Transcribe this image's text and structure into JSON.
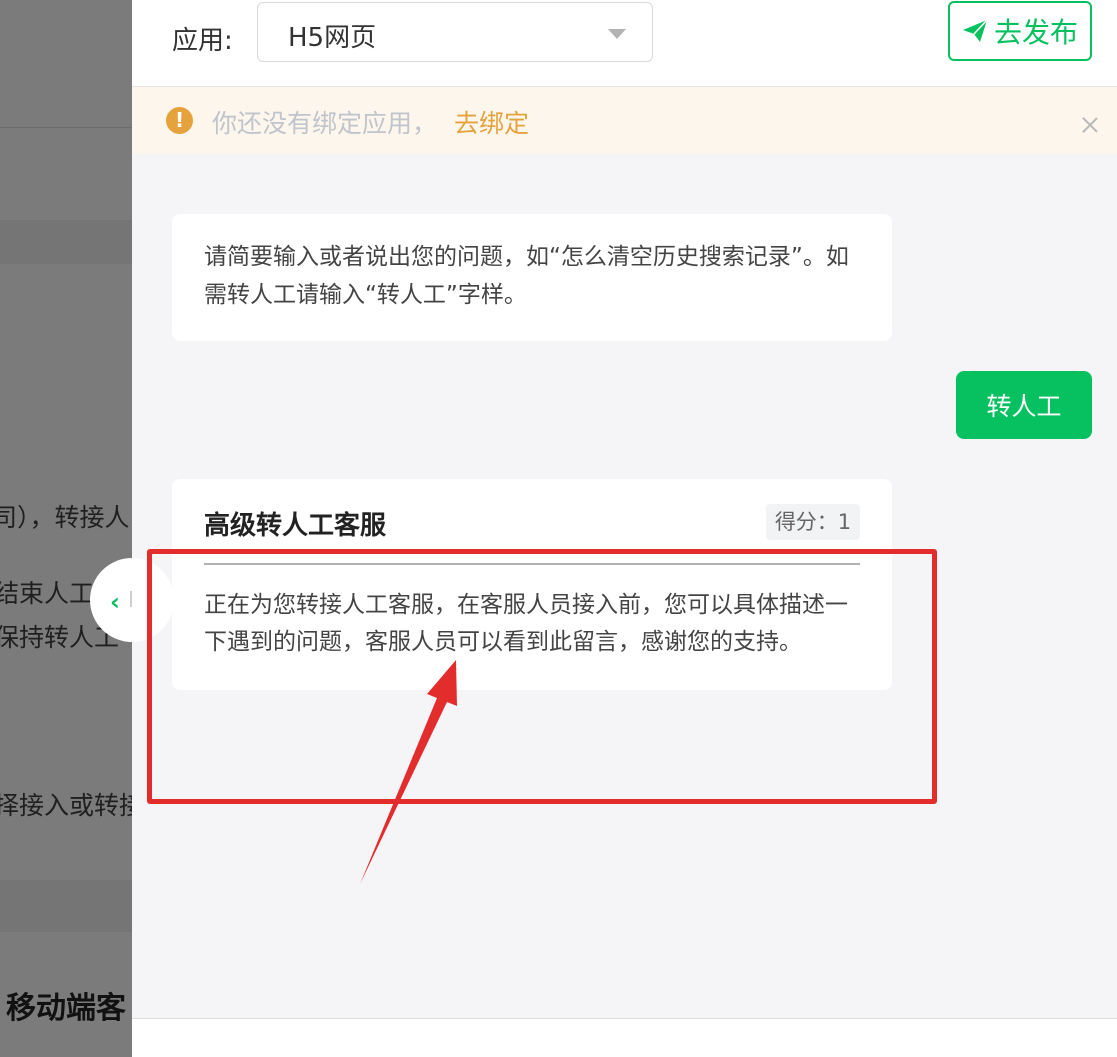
{
  "background": {
    "snippets": [
      "司），转接人",
      "结束人工",
      "保持转人工",
      "择接入或转接"
    ],
    "section_title": "移动端客"
  },
  "topbar": {
    "app_label": "应用:",
    "app_select_value": "H5网页",
    "publish_label": "去发布",
    "publish_icon": "paper-plane-icon"
  },
  "warning": {
    "text": "你还没有绑定应用，",
    "link": "去绑定",
    "icon": "exclamation-icon",
    "color": "#e6a23c"
  },
  "chat": {
    "bot_message": "请简要输入或者说出您的问题，如“怎么清空历史搜索记录”。如需转人工请输入“转人工”字样。",
    "user_message": "转人工",
    "card": {
      "title": "高级转人工客服",
      "score": "得分：1",
      "body": "正在为您转接人工客服，在客服人员接入前，您可以具体描述一下遇到的问题，客服人员可以看到此留言，感谢您的支持。"
    }
  },
  "colors": {
    "brand": "#07c160",
    "annotation": "#e32d2d"
  }
}
